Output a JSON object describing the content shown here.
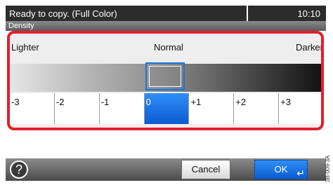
{
  "status_bar": {
    "message": "Ready to copy. (Full Color)",
    "time": "10:10"
  },
  "title_bar": {
    "title": "Density"
  },
  "scale": {
    "left_label": "Lighter",
    "center_label": "Normal",
    "right_label": "Darker"
  },
  "steps": [
    {
      "label": "-3"
    },
    {
      "label": "-2"
    },
    {
      "label": "-1"
    },
    {
      "label": "0",
      "selected": true
    },
    {
      "label": "+1"
    },
    {
      "label": "+2"
    },
    {
      "label": "+3"
    }
  ],
  "footer": {
    "help_symbol": "?",
    "cancel_label": "Cancel",
    "ok_label": "OK",
    "enter_symbol": "↵"
  },
  "side_code": "3B-009-3A"
}
